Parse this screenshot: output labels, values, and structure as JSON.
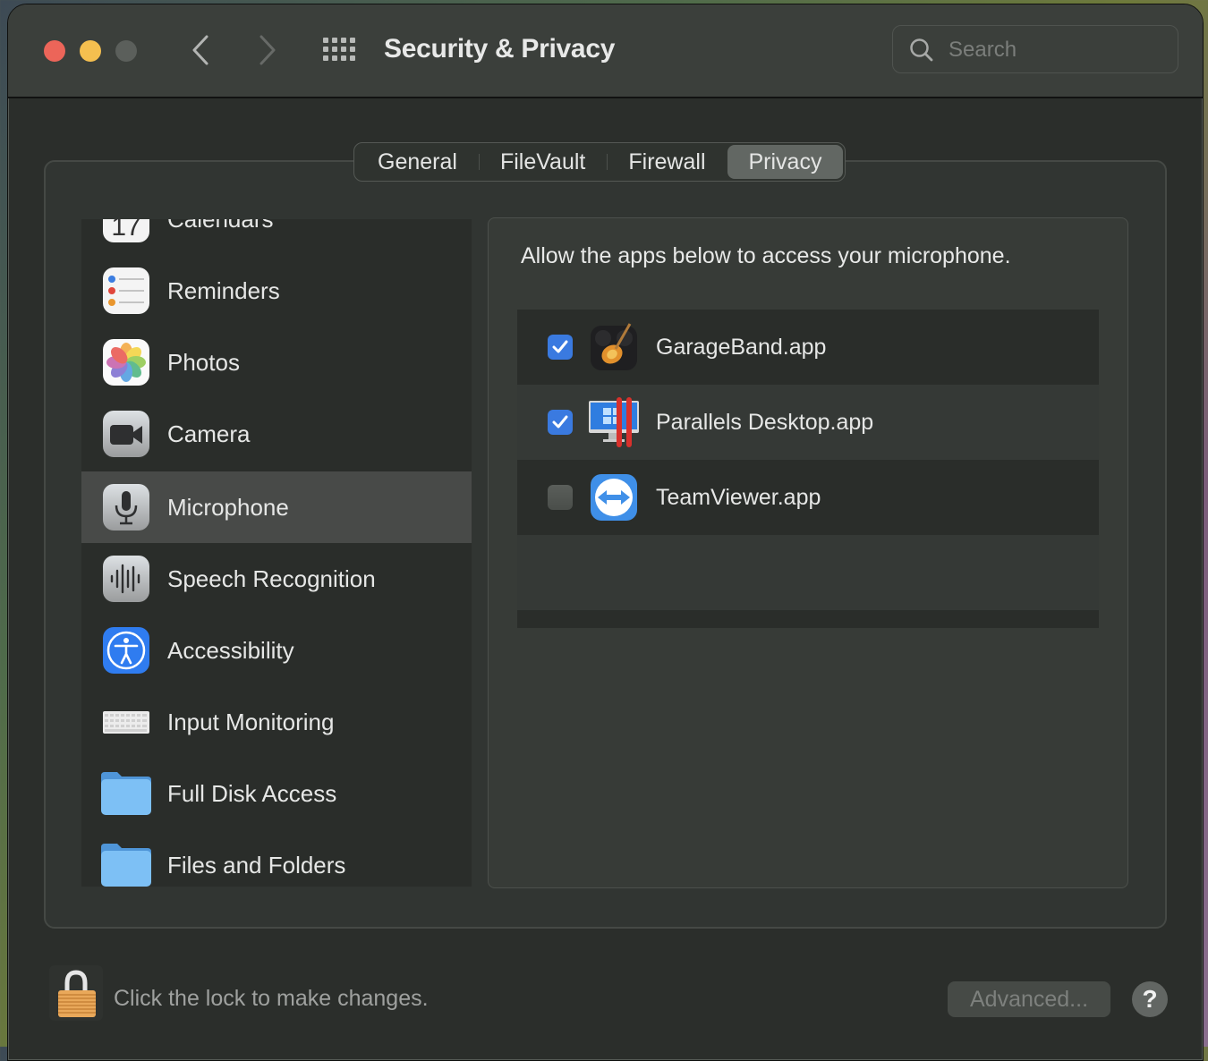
{
  "window": {
    "title": "Security & Privacy",
    "search_placeholder": "Search",
    "search_value": ""
  },
  "tabs": [
    {
      "label": "General",
      "active": false
    },
    {
      "label": "FileVault",
      "active": false
    },
    {
      "label": "Firewall",
      "active": false
    },
    {
      "label": "Privacy",
      "active": true
    }
  ],
  "sidebar": {
    "items": [
      {
        "label": "Calendars",
        "icon": "calendar-icon",
        "selected": false
      },
      {
        "label": "Reminders",
        "icon": "reminders-icon",
        "selected": false
      },
      {
        "label": "Photos",
        "icon": "photos-icon",
        "selected": false
      },
      {
        "label": "Camera",
        "icon": "camera-icon",
        "selected": false
      },
      {
        "label": "Microphone",
        "icon": "microphone-icon",
        "selected": true
      },
      {
        "label": "Speech Recognition",
        "icon": "waveform-icon",
        "selected": false
      },
      {
        "label": "Accessibility",
        "icon": "accessibility-icon",
        "selected": false
      },
      {
        "label": "Input Monitoring",
        "icon": "keyboard-icon",
        "selected": false
      },
      {
        "label": "Full Disk Access",
        "icon": "folder-icon",
        "selected": false
      },
      {
        "label": "Files and Folders",
        "icon": "folder-icon",
        "selected": false
      }
    ]
  },
  "content": {
    "description": "Allow the apps below to access your microphone.",
    "apps": [
      {
        "name": "GarageBand.app",
        "checked": true,
        "icon": "garageband-icon"
      },
      {
        "name": "Parallels Desktop.app",
        "checked": true,
        "icon": "parallels-icon"
      },
      {
        "name": "TeamViewer.app",
        "checked": false,
        "icon": "teamviewer-icon"
      }
    ]
  },
  "footer": {
    "lock_text": "Click the lock to make changes.",
    "advanced_label": "Advanced...",
    "help_label": "?"
  },
  "colors": {
    "accent": "#3a7ae0",
    "close": "#ec6559",
    "minimize": "#f5bf4f",
    "maximize_disabled": "#5b5f5b"
  }
}
